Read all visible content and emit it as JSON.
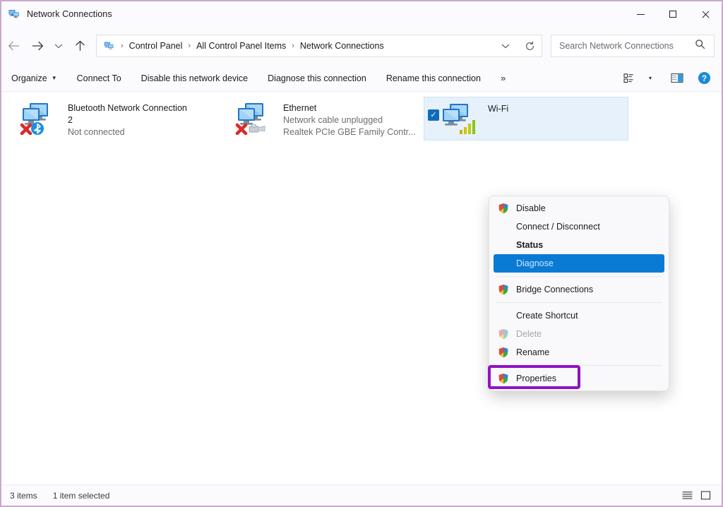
{
  "window": {
    "title": "Network Connections",
    "icon": "network-connections-icon",
    "border_color": "#c9a8cc",
    "controls": {
      "minimize": "minimize-button",
      "maximize": "maximize-button",
      "close": "close-button"
    }
  },
  "addressbar": {
    "back": "←",
    "forward": "→",
    "recent": "⌄",
    "up": "↑",
    "breadcrumbs": [
      {
        "label": "Control Panel"
      },
      {
        "label": "All Control Panel Items"
      },
      {
        "label": "Network Connections"
      }
    ],
    "separator": "›",
    "dropdown_icon": "chevron-down-icon",
    "refresh_icon": "refresh-icon",
    "search": {
      "placeholder": "Search Network Connections",
      "icon": "search-icon"
    }
  },
  "toolbar": {
    "items": [
      {
        "label": "Organize",
        "has_caret": true
      },
      {
        "label": "Connect To",
        "has_caret": false
      },
      {
        "label": "Disable this network device",
        "has_caret": false
      },
      {
        "label": "Diagnose this connection",
        "has_caret": false
      },
      {
        "label": "Rename this connection",
        "has_caret": false
      }
    ],
    "overflow": "»",
    "view_icon": "view-options-icon",
    "view_caret": "▾",
    "preview_pane_icon": "preview-pane-icon",
    "help_icon": "help-icon"
  },
  "adapters": [
    {
      "name": "Bluetooth Network Connection",
      "name_line2": "2",
      "status": "Not connected",
      "device": "",
      "icon": "bluetooth-network-adapter-icon",
      "error": true,
      "selected": false
    },
    {
      "name": "Ethernet",
      "name_line2": "",
      "status": "Network cable unplugged",
      "device": "Realtek PCIe GBE Family Contr...",
      "icon": "ethernet-adapter-icon",
      "error": true,
      "selected": false
    },
    {
      "name": "Wi-Fi",
      "name_line2": "",
      "status": "",
      "device": "",
      "icon": "wifi-adapter-icon",
      "error": false,
      "selected": true
    }
  ],
  "context_menu": {
    "items": [
      {
        "label": "Disable",
        "shield": true,
        "state": "normal"
      },
      {
        "label": "Connect / Disconnect",
        "shield": false,
        "state": "normal"
      },
      {
        "label": "Status",
        "shield": false,
        "state": "bold"
      },
      {
        "label": "Diagnose",
        "shield": false,
        "state": "highlighted"
      },
      {
        "separator": true
      },
      {
        "label": "Bridge Connections",
        "shield": true,
        "state": "normal"
      },
      {
        "separator": true
      },
      {
        "label": "Create Shortcut",
        "shield": false,
        "state": "normal"
      },
      {
        "label": "Delete",
        "shield": true,
        "state": "disabled"
      },
      {
        "label": "Rename",
        "shield": true,
        "state": "normal"
      },
      {
        "separator": true
      },
      {
        "label": "Properties",
        "shield": true,
        "state": "normal"
      }
    ],
    "highlight_color": "#0a7bd4",
    "annotation_color": "#9012c2",
    "annotated_item": "Properties"
  },
  "statusbar": {
    "item_count": "3 items",
    "selection": "1 item selected",
    "list_view_icon": "list-view-icon",
    "large_icons_view_icon": "large-icons-view-icon"
  }
}
